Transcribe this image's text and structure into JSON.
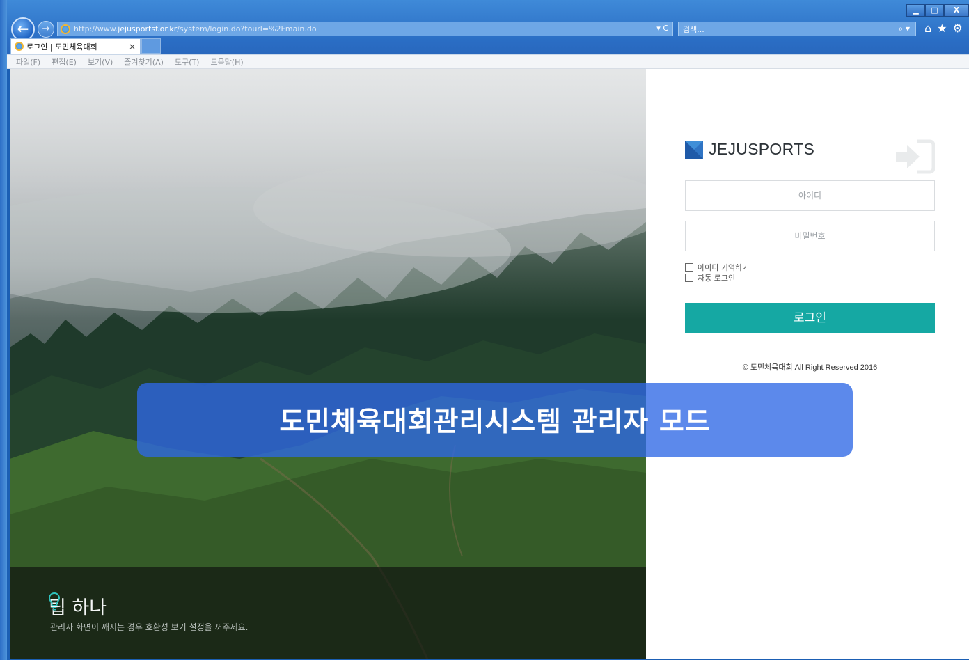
{
  "browser": {
    "url_prefix": "http://www.",
    "url_host": "jejusportsf.or.kr",
    "url_path": "/system/login.do?tourl=%2Fmain.do",
    "address_tools": "▾ C",
    "search_placeholder": "검색...",
    "search_tools": "⌕ ▾",
    "tab_title": "로그인 | 도민체육대회",
    "tab_close": "×",
    "back_glyph": "←",
    "forward_glyph": "→",
    "window_controls": [
      "▁",
      "□",
      "X"
    ],
    "toolbar_icons": [
      "home-icon",
      "star-icon",
      "gear-icon"
    ],
    "toolbar_glyphs": [
      "⌂",
      "★",
      "⚙"
    ],
    "menu": [
      "파일(F)",
      "편집(E)",
      "보기(V)",
      "즐겨찾기(A)",
      "도구(T)",
      "도움말(H)"
    ]
  },
  "page": {
    "tip": {
      "title": "팁 하나",
      "text": "관리자 화면이 깨지는 경우 호환성 보기 설정을 꺼주세요."
    },
    "login": {
      "brand": "JEJUSPORTS",
      "id_placeholder": "아이디",
      "pw_placeholder": "비밀번호",
      "remember_id": "아이디 기억하기",
      "auto_login": "자동 로그인",
      "button": "로그인",
      "copyright": "© 도민체육대회 All Right Reserved 2016"
    },
    "banner": "도민체육대회관리시스템 관리자 모드"
  },
  "colors": {
    "accent": "#15a8a3",
    "banner": "#2e68e6",
    "chrome": "#2a6dc4"
  }
}
